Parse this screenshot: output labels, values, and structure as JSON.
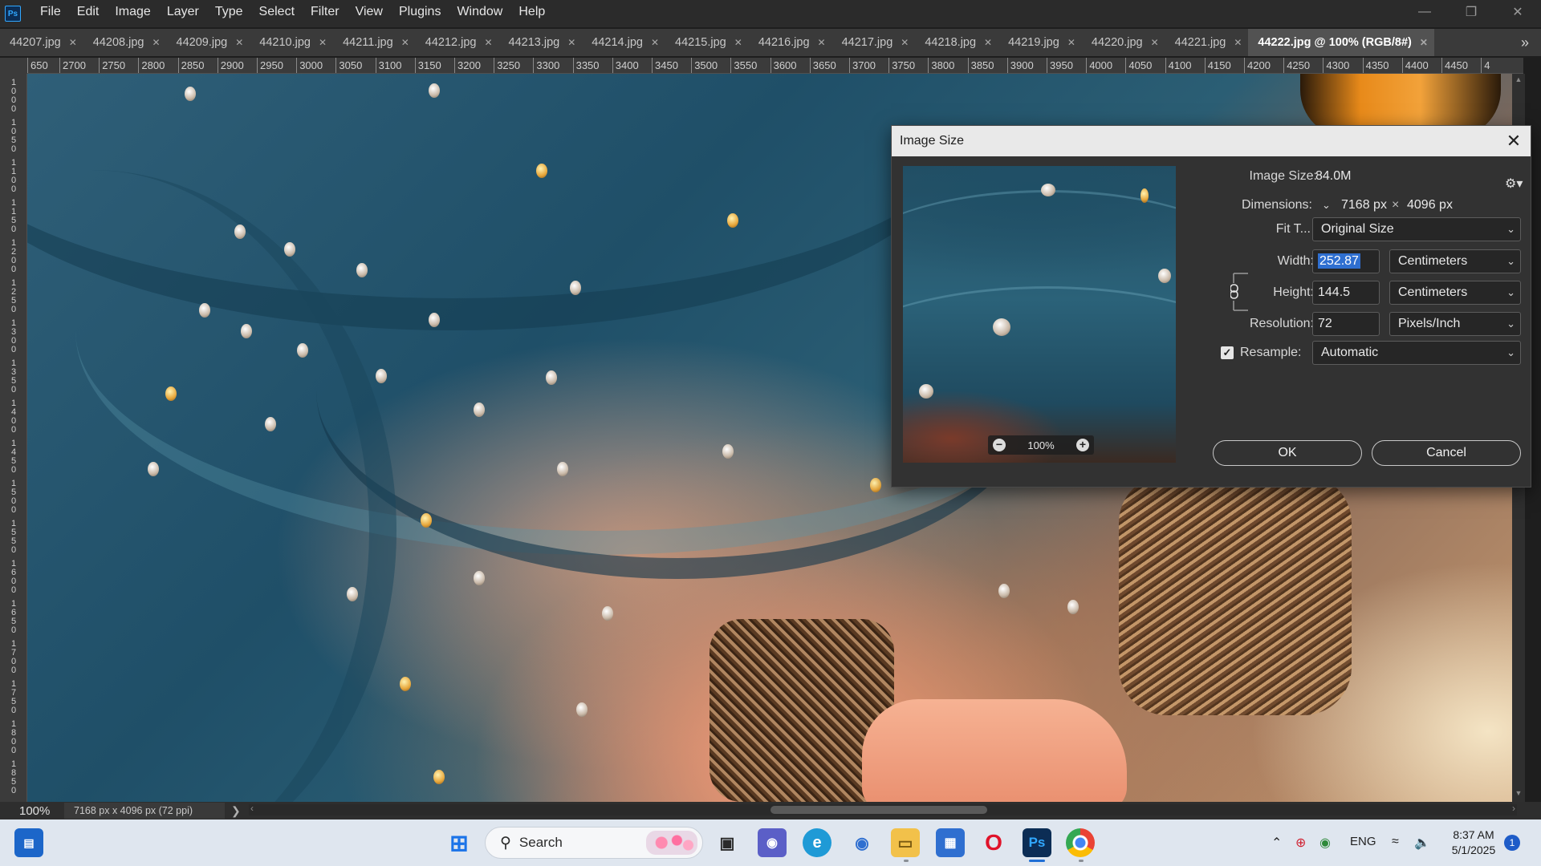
{
  "app": {
    "logo": "Ps",
    "menu": [
      "File",
      "Edit",
      "Image",
      "Layer",
      "Type",
      "Select",
      "Filter",
      "View",
      "Plugins",
      "Window",
      "Help"
    ]
  },
  "tabs": [
    {
      "label": "44207.jpg"
    },
    {
      "label": "44208.jpg"
    },
    {
      "label": "44209.jpg"
    },
    {
      "label": "44210.jpg"
    },
    {
      "label": "44211.jpg"
    },
    {
      "label": "44212.jpg"
    },
    {
      "label": "44213.jpg"
    },
    {
      "label": "44214.jpg"
    },
    {
      "label": "44215.jpg"
    },
    {
      "label": "44216.jpg"
    },
    {
      "label": "44217.jpg"
    },
    {
      "label": "44218.jpg"
    },
    {
      "label": "44219.jpg"
    },
    {
      "label": "44220.jpg"
    },
    {
      "label": "44221.jpg"
    },
    {
      "label": "44222.jpg @ 100% (RGB/8#)",
      "active": true
    }
  ],
  "ruler": {
    "top_labels": [
      "650",
      "2700",
      "2750",
      "2800",
      "2850",
      "2900",
      "2950",
      "3000",
      "3050",
      "3100",
      "3150",
      "3200",
      "3250",
      "3300",
      "3350",
      "3400",
      "3450",
      "3500",
      "3550",
      "3600",
      "3650",
      "3700",
      "3750",
      "3800",
      "3850",
      "3900",
      "3950",
      "4000",
      "4050",
      "4100",
      "4150",
      "4200",
      "4250",
      "4300",
      "4350",
      "4400",
      "4450",
      "4"
    ],
    "left_labels": [
      "1000",
      "1050",
      "1100",
      "1150",
      "1200",
      "1250",
      "1300",
      "1350",
      "1400",
      "1450",
      "1500",
      "1550",
      "1600",
      "1650",
      "1700",
      "1750",
      "1800",
      "1850"
    ]
  },
  "dialog": {
    "title": "Image Size",
    "image_size_label": "Image Size:",
    "image_size_value": "84.0M",
    "dimensions_label": "Dimensions:",
    "dimensions_width": "7168 px",
    "dimensions_x": "×",
    "dimensions_height": "4096 px",
    "fit_to_label": "Fit T...",
    "fit_to_value": "Original Size",
    "width_label": "Width:",
    "width_value": "252.87",
    "width_unit": "Centimeters",
    "height_label": "Height:",
    "height_value": "144.5",
    "height_unit": "Centimeters",
    "resolution_label": "Resolution:",
    "resolution_value": "72",
    "resolution_unit": "Pixels/Inch",
    "resample_label": "Resample:",
    "resample_checked": true,
    "resample_value": "Automatic",
    "preview_zoom": "100%",
    "ok_label": "OK",
    "cancel_label": "Cancel"
  },
  "status": {
    "zoom": "100%",
    "doc_info": "7168 px x 4096 px (72 ppi)"
  },
  "taskbar": {
    "search_label": "Search",
    "language": "ENG",
    "time": "8:37 AM",
    "date": "5/1/2025",
    "notifications": "1"
  },
  "colors": {
    "accent": "#31a8ff",
    "selection": "#2f6fd0",
    "dialog_bg": "#323232",
    "taskbar_bg": "#dfe6ef"
  }
}
